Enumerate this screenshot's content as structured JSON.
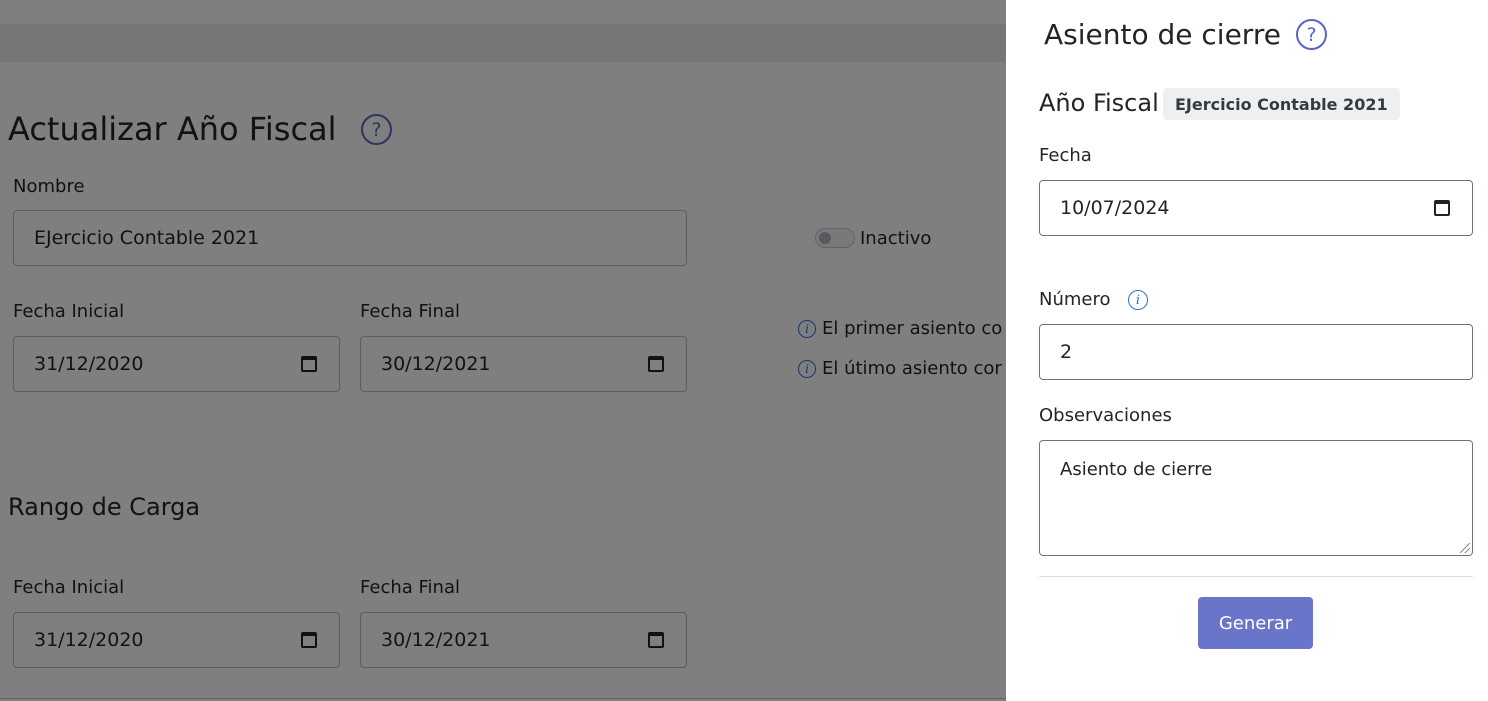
{
  "background": {
    "title": "Actualizar Año Fiscal",
    "nombre_label": "Nombre",
    "nombre_value": "EJercicio Contable 2021",
    "status_label": "Inactivo",
    "fecha_inicial_label": "Fecha Inicial",
    "fecha_inicial_value": "31/12/2020",
    "fecha_final_label": "Fecha Final",
    "fecha_final_value": "30/12/2021",
    "info_first": "El primer asiento co",
    "info_last": "El útimo asiento cor",
    "rango_title": "Rango de Carga",
    "rango_inicial_label": "Fecha Inicial",
    "rango_inicial_value": "31/12/2020",
    "rango_final_label": "Fecha Final",
    "rango_final_value": "30/12/2021"
  },
  "drawer": {
    "title": "Asiento de cierre",
    "fiscal_year_label": "Año Fiscal",
    "fiscal_year_badge": "EJercicio Contable 2021",
    "fecha_label": "Fecha",
    "fecha_value": "10/07/2024",
    "numero_label": "Número",
    "numero_value": "2",
    "observaciones_label": "Observaciones",
    "observaciones_value": "Asiento de cierre",
    "generate_label": "Generar"
  },
  "icons": {
    "help": "?",
    "info": "i"
  },
  "colors": {
    "accent": "#6975c9",
    "help": "#5a66c4",
    "info": "#2f6fd6"
  }
}
